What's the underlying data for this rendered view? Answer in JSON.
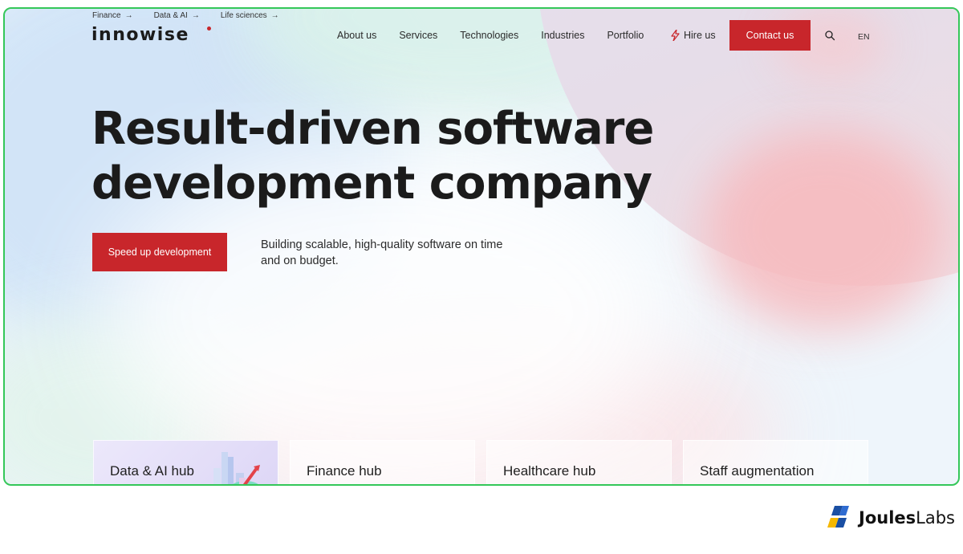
{
  "top_links": [
    {
      "label": "Finance",
      "arrow": "→"
    },
    {
      "label": "Data & AI",
      "arrow": "→"
    },
    {
      "label": "Life sciences",
      "arrow": "→"
    }
  ],
  "logo": {
    "text": "innowise"
  },
  "nav": {
    "items": [
      "About us",
      "Services",
      "Technologies",
      "Industries",
      "Portfolio"
    ],
    "hire_label": "Hire us",
    "contact_label": "Contact us",
    "language": "EN"
  },
  "hero": {
    "title_line1": "Result-driven software",
    "title_line2": "development company",
    "cta_label": "Speed up development",
    "subtitle": "Building scalable, high-quality software on time and on budget."
  },
  "hubs": [
    "Data & AI hub",
    "Finance hub",
    "Healthcare hub",
    "Staff augmentation"
  ],
  "watermark": {
    "brand_bold": "Joules",
    "brand_light": "Labs"
  },
  "colors": {
    "accent": "#c8262b",
    "frame_border": "#34c759"
  }
}
